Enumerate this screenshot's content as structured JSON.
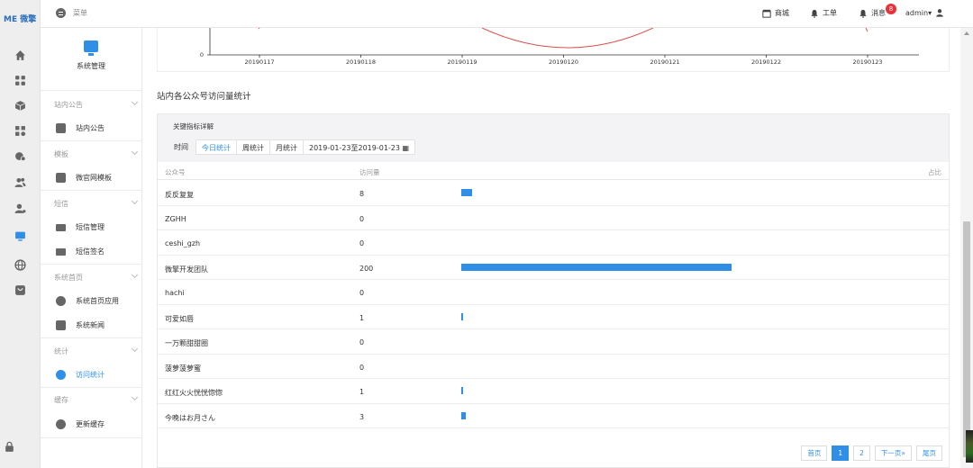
{
  "brand": {
    "logo_text": "ME 微擎"
  },
  "header": {
    "menu_label": "菜单",
    "shop_label": "商城",
    "ticket_label": "工单",
    "messages_label": "消息",
    "messages_badge": "8",
    "user_label": "admin▾"
  },
  "rail": {
    "icons": [
      "home-icon",
      "apps-grid-icon",
      "cube-icon",
      "modules-icon",
      "store-icon",
      "users-icon",
      "user-admin-icon",
      "monitor-icon",
      "globe-icon",
      "app-store-icon",
      "lock-icon"
    ]
  },
  "subnav": {
    "title": "系统管理",
    "groups": [
      {
        "label": "站内公告",
        "items": [
          {
            "label": "站内公告",
            "icon": "notice-icon"
          }
        ]
      },
      {
        "label": "模板",
        "items": [
          {
            "label": "微官网模板",
            "icon": "template-icon"
          }
        ]
      },
      {
        "label": "短信",
        "items": [
          {
            "label": "短信管理",
            "icon": "mail-icon"
          },
          {
            "label": "短信签名",
            "icon": "mail-icon"
          }
        ]
      },
      {
        "label": "系统首页",
        "items": [
          {
            "label": "系统首页应用",
            "icon": "app-icon"
          },
          {
            "label": "系统新闻",
            "icon": "news-icon"
          }
        ]
      },
      {
        "label": "统计",
        "items": [
          {
            "label": "访问统计",
            "icon": "pie-icon",
            "active": true
          }
        ]
      },
      {
        "label": "缓存",
        "items": [
          {
            "label": "更新缓存",
            "icon": "refresh-icon"
          }
        ]
      }
    ]
  },
  "chart": {
    "y_tick": "0",
    "x_ticks": [
      "20190117",
      "20190118",
      "20190119",
      "20190120",
      "20190121",
      "20190122",
      "20190123"
    ],
    "line_color": "#d9534f"
  },
  "section_title": "站内各公众号访问量统计",
  "panel": {
    "title": "关键指标详解",
    "filter_label": "时间",
    "tabs": [
      "今日统计",
      "周统计",
      "月统计"
    ],
    "active_tab": "今日统计",
    "date_range": "2019-01-23至2019-01-23"
  },
  "table": {
    "headers": {
      "name": "公众号",
      "visits": "访问量",
      "ratio": "占比"
    },
    "rows": [
      {
        "name": "反反复复",
        "visits": "8",
        "share": 0.04
      },
      {
        "name": "ZGHH",
        "visits": "0",
        "share": 0
      },
      {
        "name": "ceshi_gzh",
        "visits": "0",
        "share": 0
      },
      {
        "name": "微擎开发团队",
        "visits": "200",
        "share": 1.0
      },
      {
        "name": "hachi",
        "visits": "0",
        "share": 0
      },
      {
        "name": "可爱如唇",
        "visits": "1",
        "share": 0.005
      },
      {
        "name": "一万颗甜甜圈",
        "visits": "0",
        "share": 0
      },
      {
        "name": "菠萝菠萝蜜",
        "visits": "0",
        "share": 0
      },
      {
        "name": "红红火火恍恍惚惚",
        "visits": "1",
        "share": 0.005
      },
      {
        "name": "今晚はお月さん",
        "visits": "3",
        "share": 0.015
      }
    ],
    "bar_color": "#2f8fe6"
  },
  "pagination": {
    "first": "首页",
    "pages": [
      "1",
      "2"
    ],
    "current": "1",
    "next": "下一页»",
    "last": "尾页"
  }
}
